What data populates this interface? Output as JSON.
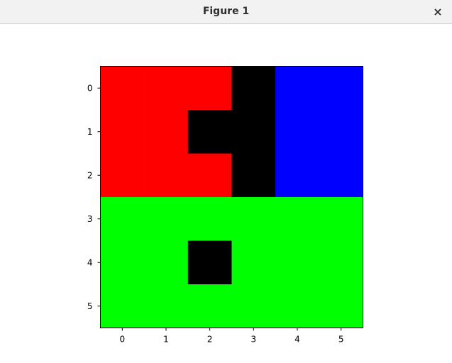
{
  "window": {
    "title": "Figure 1",
    "close_glyph": "×"
  },
  "chart_data": {
    "type": "heatmap",
    "title": "",
    "xlabel": "",
    "ylabel": "",
    "x_ticks": [
      "0",
      "1",
      "2",
      "3",
      "4",
      "5"
    ],
    "y_ticks": [
      "0",
      "1",
      "2",
      "3",
      "4",
      "5"
    ],
    "xlim": [
      -0.5,
      5.5
    ],
    "ylim": [
      5.5,
      -0.5
    ],
    "grid": false,
    "colors": {
      "red": "#ff0000",
      "green": "#00ff00",
      "blue": "#0000ff",
      "black": "#000000"
    },
    "cells": [
      [
        "red",
        "red",
        "red",
        "black",
        "blue",
        "blue"
      ],
      [
        "red",
        "red",
        "black",
        "black",
        "blue",
        "blue"
      ],
      [
        "red",
        "red",
        "red",
        "black",
        "blue",
        "blue"
      ],
      [
        "green",
        "green",
        "green",
        "green",
        "green",
        "green"
      ],
      [
        "green",
        "green",
        "black",
        "green",
        "green",
        "green"
      ],
      [
        "green",
        "green",
        "green",
        "green",
        "green",
        "green"
      ]
    ]
  }
}
